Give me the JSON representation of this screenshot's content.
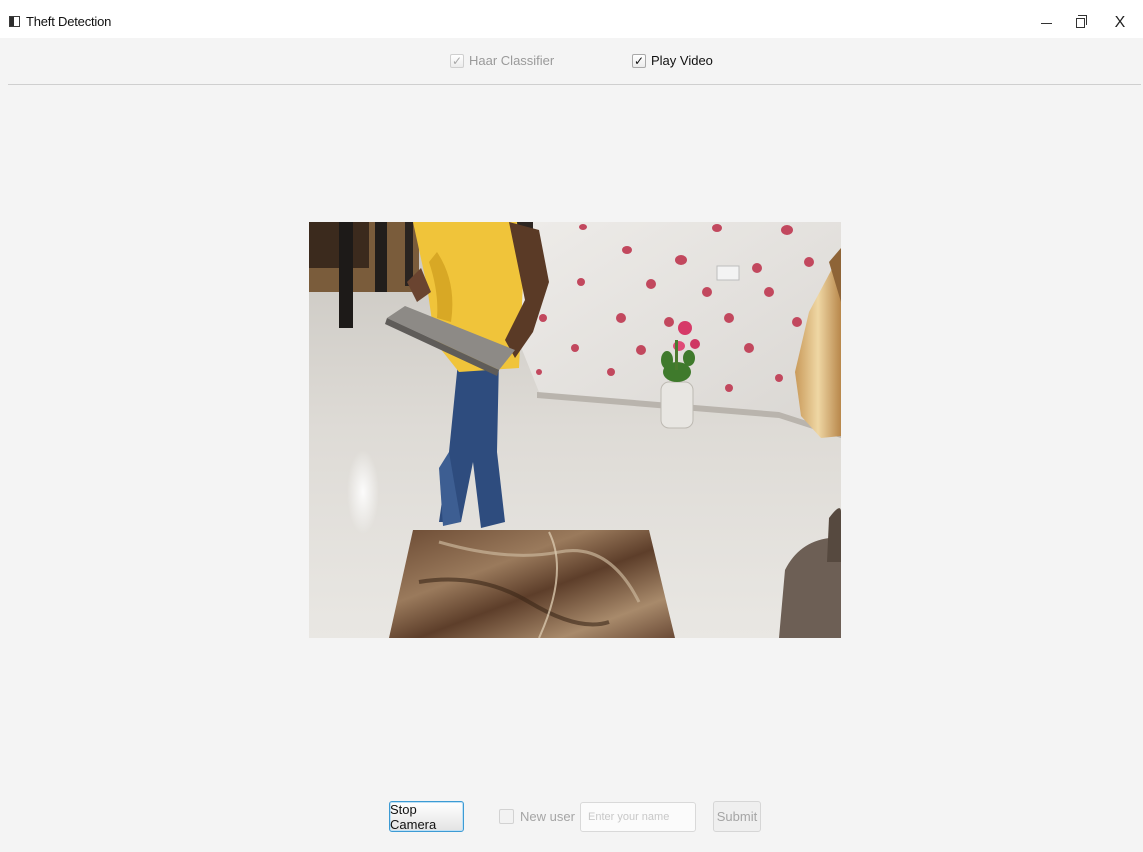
{
  "window": {
    "title": "Theft Detection",
    "controls": {
      "minimize": "minimize-icon",
      "maximize": "restore-icon",
      "close_glyph": "X"
    }
  },
  "toolbar": {
    "haar_classifier": {
      "label": "Haar Classifier",
      "checked": true,
      "enabled": false
    },
    "play_video": {
      "label": "Play Video",
      "checked": true,
      "enabled": true
    },
    "check_glyph": "✓"
  },
  "video": {
    "description_icon": "camera-feed"
  },
  "controls": {
    "stop_camera_label": "Stop Camera",
    "new_user_label": "New user",
    "new_user_checked": false,
    "name_placeholder": "Enter your name",
    "name_value": "",
    "submit_label": "Submit"
  },
  "colors": {
    "background": "#f4f4f4",
    "focus_accent": "#3c9bd4",
    "disabled_text": "#a5a5a5"
  }
}
